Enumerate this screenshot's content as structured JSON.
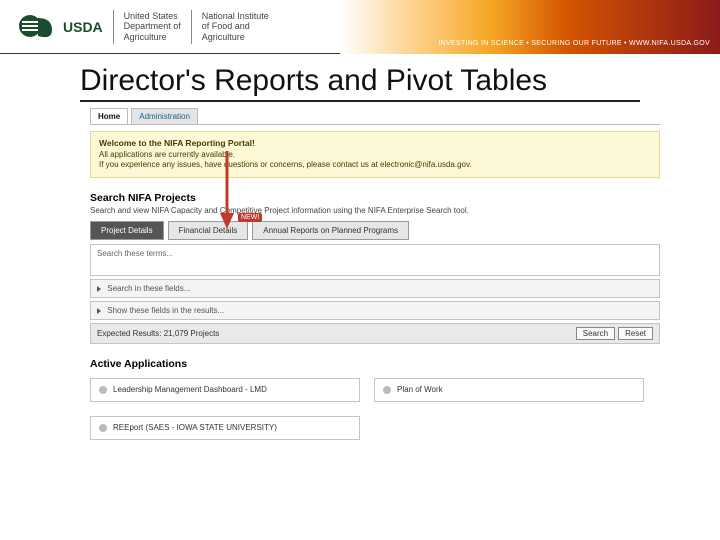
{
  "banner": {
    "usda_abbr": "USDA",
    "org1_line1": "United States",
    "org1_line2": "Department of",
    "org1_line3": "Agriculture",
    "org2_line1": "National Institute",
    "org2_line2": "of Food and",
    "org2_line3": "Agriculture",
    "tagline": "INVESTING IN SCIENCE • SECURING OUR FUTURE • WWW.NIFA.USDA.GOV"
  },
  "title": "Director's Reports and Pivot Tables",
  "nav": {
    "home": "Home",
    "admin": "Administration"
  },
  "welcome": {
    "title": "Welcome to the NIFA Reporting Portal!",
    "line1": "All applications are currently available.",
    "line2": "If you experience any issues, have questions or concerns, please contact us at electronic@nifa.usda.gov."
  },
  "search": {
    "header": "Search NIFA Projects",
    "sub": "Search and view NIFA Capacity and Competitive Project information using the NIFA Enterprise Search tool.",
    "tab_project": "Project Details",
    "tab_financial": "Financial Details",
    "tab_annual": "Annual Reports on Planned Programs",
    "new_badge": "NEW!",
    "search_terms": "Search these terms...",
    "fields": "Search in these fields...",
    "show_fields": "Show these fields in the results...",
    "expected": "Expected Results: 21,079 Projects",
    "search_btn": "Search",
    "reset_btn": "Reset"
  },
  "apps": {
    "header": "Active Applications",
    "card1": "Leadership Management Dashboard - LMD",
    "card2": "Plan of Work",
    "card3": "REEport (SAES - IOWA STATE UNIVERSITY)"
  }
}
